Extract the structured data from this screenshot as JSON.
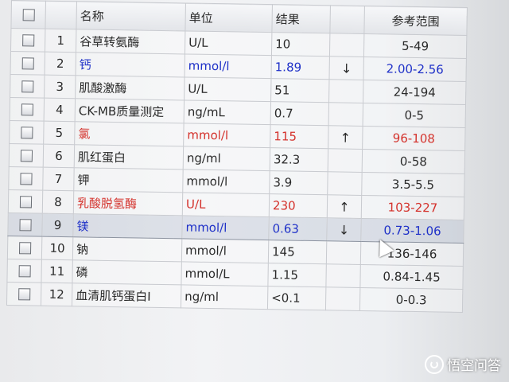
{
  "header": {
    "name": "名称",
    "unit": "单位",
    "result": "结果",
    "reference": "参考范围"
  },
  "rows": [
    {
      "num": "1",
      "name": "谷草转氨酶",
      "unit": "U/L",
      "result": "10",
      "flag": "",
      "reference": "5-49",
      "color": "normal"
    },
    {
      "num": "2",
      "name": "钙",
      "unit": "mmol/l",
      "result": "1.89",
      "flag": "↓",
      "reference": "2.00-2.56",
      "color": "blue"
    },
    {
      "num": "3",
      "name": "肌酸激酶",
      "unit": "U/L",
      "result": "51",
      "flag": "",
      "reference": "24-194",
      "color": "normal"
    },
    {
      "num": "4",
      "name": "CK-MB质量测定",
      "unit": "ng/mL",
      "result": "0.7",
      "flag": "",
      "reference": "0-5",
      "color": "normal"
    },
    {
      "num": "5",
      "name": "氯",
      "unit": "mmol/l",
      "result": "115",
      "flag": "↑",
      "reference": "96-108",
      "color": "red"
    },
    {
      "num": "6",
      "name": "肌红蛋白",
      "unit": "ng/ml",
      "result": "32.3",
      "flag": "",
      "reference": "0-58",
      "color": "normal"
    },
    {
      "num": "7",
      "name": "钾",
      "unit": "mmol/l",
      "result": "3.9",
      "flag": "",
      "reference": "3.5-5.5",
      "color": "normal"
    },
    {
      "num": "8",
      "name": "乳酸脱氢酶",
      "unit": "U/L",
      "result": "230",
      "flag": "↑",
      "reference": "103-227",
      "color": "red"
    },
    {
      "num": "9",
      "name": "镁",
      "unit": "mmol/l",
      "result": "0.63",
      "flag": "↓",
      "reference": "0.73-1.06",
      "color": "blue"
    },
    {
      "num": "10",
      "name": "钠",
      "unit": "mmol/l",
      "result": "145",
      "flag": "",
      "reference": "136-146",
      "color": "normal"
    },
    {
      "num": "11",
      "name": "磷",
      "unit": "mmol/L",
      "result": "1.15",
      "flag": "",
      "reference": "0.84-1.45",
      "color": "normal"
    },
    {
      "num": "12",
      "name": "血清肌钙蛋白I",
      "unit": "ng/ml",
      "result": "<0.1",
      "flag": "",
      "reference": "0-0.3",
      "color": "normal"
    }
  ],
  "selected_row": "9",
  "watermark": "悟空问答",
  "colors": {
    "high": "#d4322c",
    "low": "#1f31c8"
  }
}
